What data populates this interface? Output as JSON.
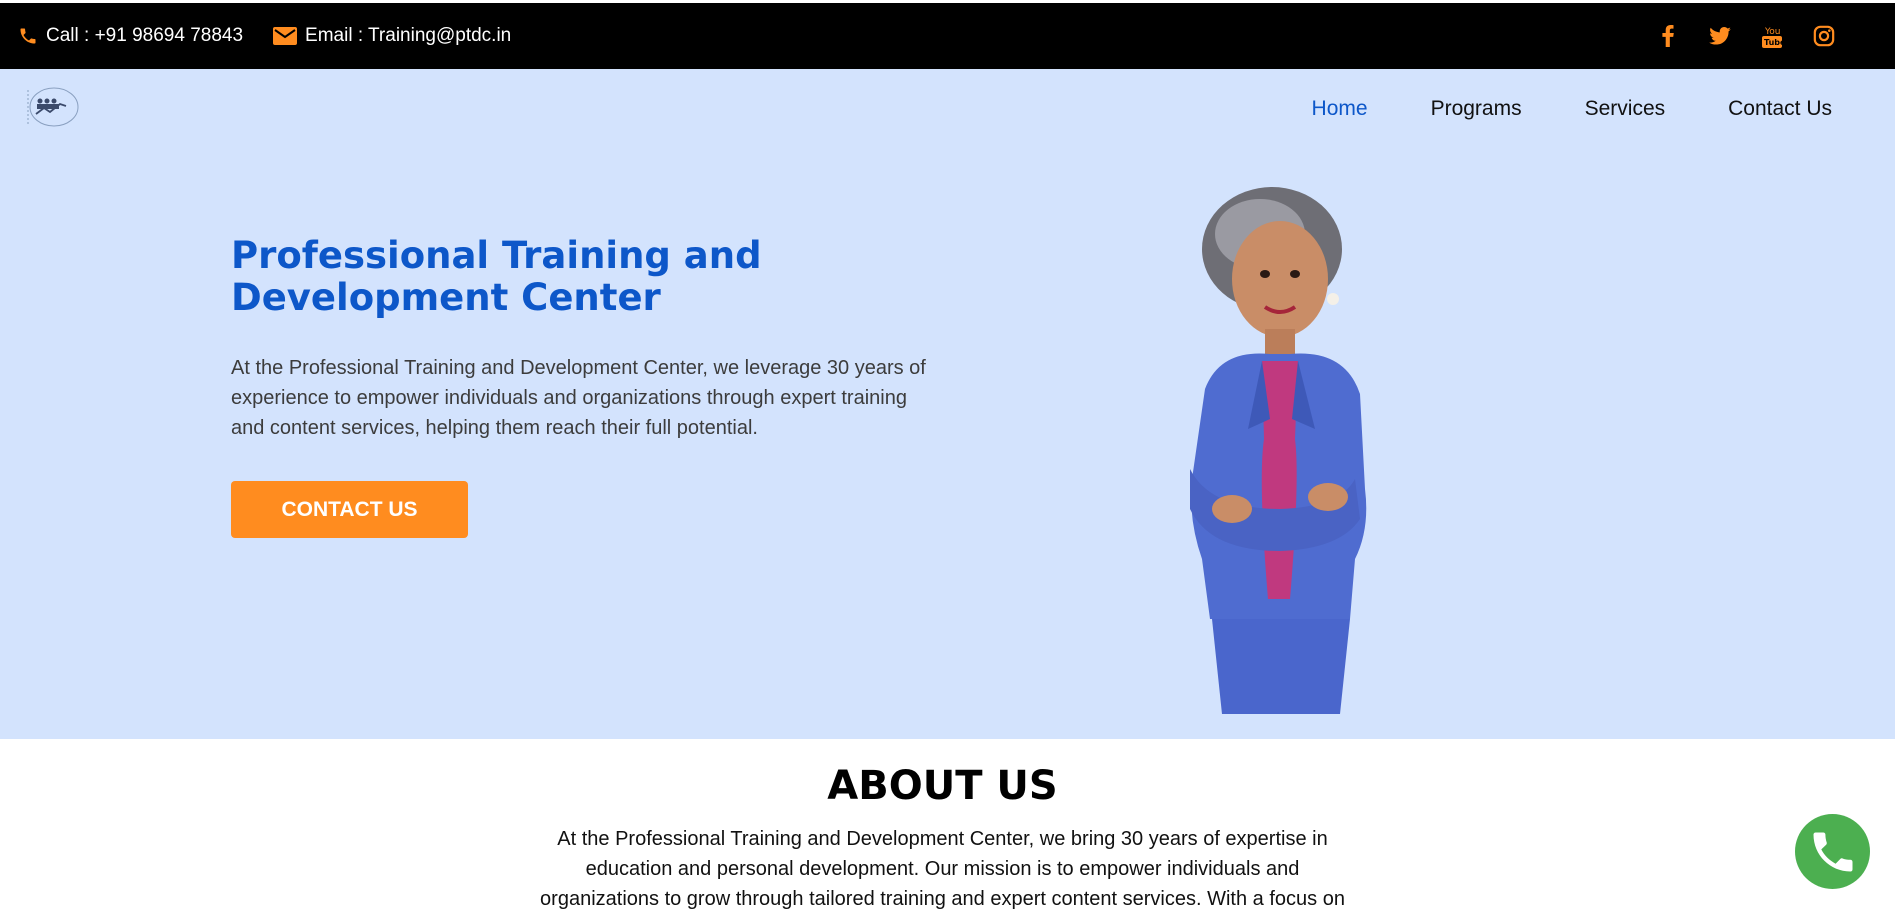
{
  "topbar": {
    "phone": "Call : +91 98694 78843",
    "email": "Email : Training@ptdc.in",
    "social_icons": [
      "facebook-icon",
      "twitter-icon",
      "youtube-icon",
      "instagram-icon"
    ]
  },
  "nav": {
    "items": [
      {
        "label": "Home",
        "active": true
      },
      {
        "label": "Programs",
        "active": false
      },
      {
        "label": "Services",
        "active": false
      },
      {
        "label": "Contact Us",
        "active": false
      }
    ]
  },
  "hero": {
    "title": "Professional Training and Development Center",
    "text": "At the Professional Training and Development Center, we leverage 30 years of experience to empower individuals and organizations through expert training and content services, helping them reach their full potential.",
    "cta_label": "CONTACT US"
  },
  "about": {
    "title": "ABOUT US",
    "text": "At the Professional Training and Development Center, we bring 30 years of expertise in education and personal development. Our mission is to empower individuals and organizations to grow through tailored training and expert content services. With a focus on"
  },
  "colors": {
    "topbar_bg": "#000000",
    "accent_orange": "#ff8c1f",
    "brand_blue": "#0d57c9",
    "hero_bg": "#d3e3fd",
    "whatsapp_green": "#4caf50"
  }
}
